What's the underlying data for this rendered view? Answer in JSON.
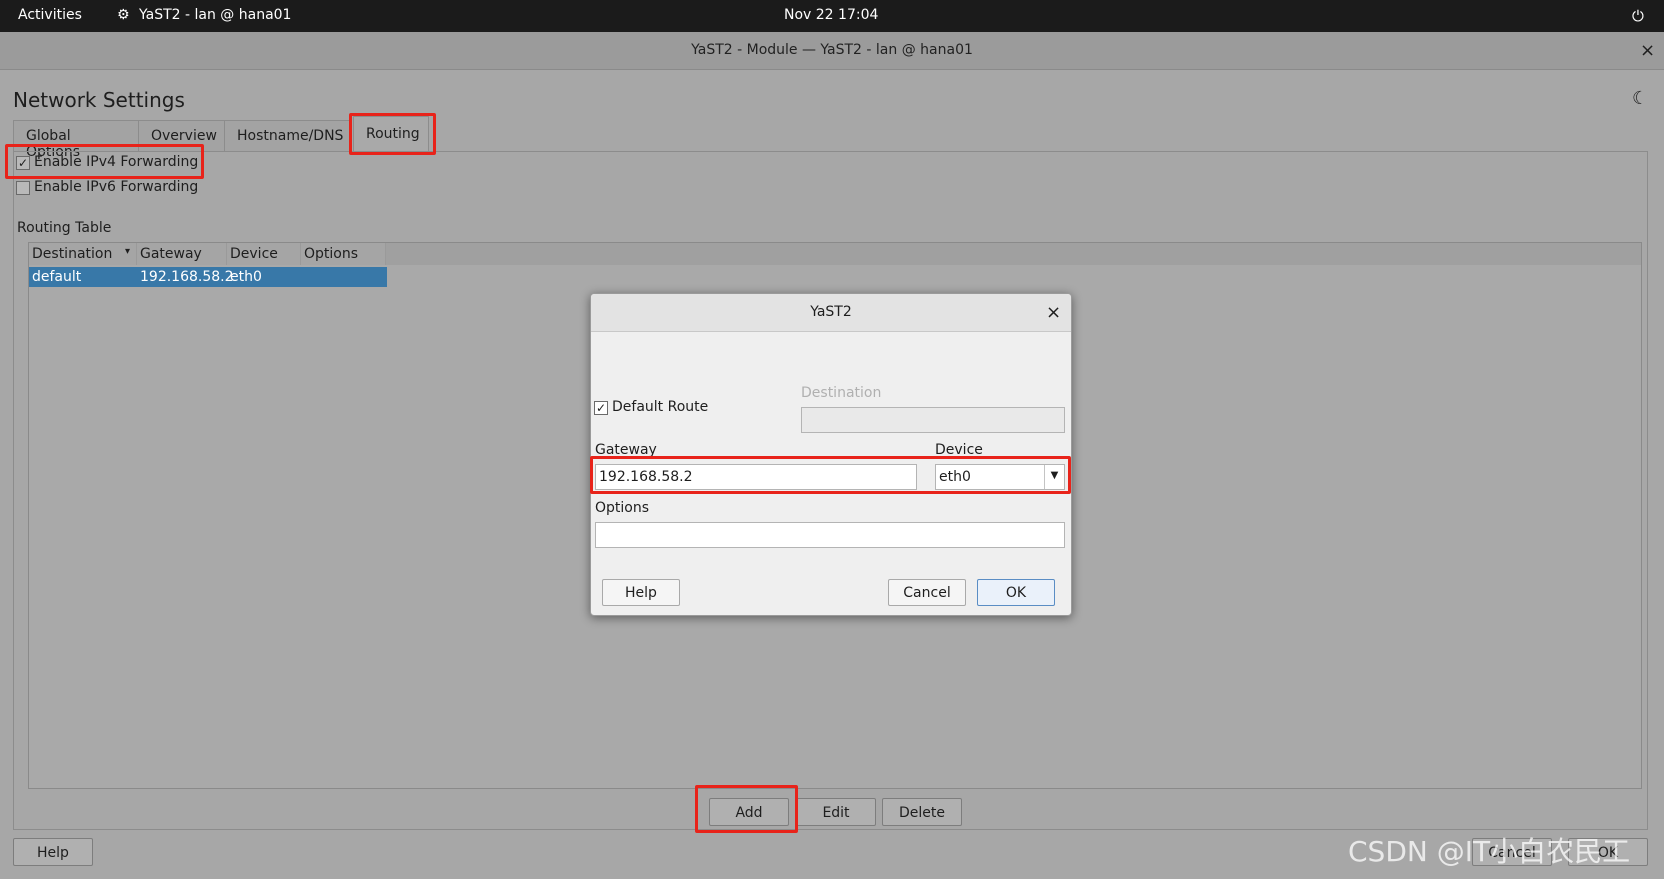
{
  "topbar": {
    "activities": "Activities",
    "app_name": "YaST2 - lan @ hana01",
    "clock": "Nov 22  17:04"
  },
  "window": {
    "title": "YaST2 - Module — YaST2 - lan @ hana01",
    "close": "×"
  },
  "page": {
    "title": "Network Settings",
    "tabs": [
      "Global Options",
      "Overview",
      "Hostname/DNS",
      "Routing"
    ],
    "active_tab": "Routing"
  },
  "routing": {
    "ipv4_label": "Enable IPv4 Forwarding",
    "ipv4_checked": true,
    "ipv6_label": "Enable IPv6 Forwarding",
    "ipv6_checked": false,
    "table_title": "Routing Table",
    "columns": [
      "Destination",
      "Gateway",
      "Device",
      "Options"
    ],
    "rows": [
      {
        "destination": "default",
        "gateway": "192.168.58.2",
        "device": "eth0",
        "options": ""
      }
    ],
    "add": "Add",
    "edit": "Edit",
    "delete": "Delete"
  },
  "footer": {
    "help": "Help",
    "cancel": "Cancel",
    "ok": "OK",
    "watermark": "CSDN @IT小白农民工"
  },
  "dialog": {
    "title": "YaST2",
    "close": "×",
    "default_route_label": "Default Route",
    "default_route_checked": true,
    "destination_label": "Destination",
    "destination_value": "",
    "gateway_label": "Gateway",
    "gateway_value": "192.168.58.2",
    "device_label": "Device",
    "device_value": "eth0",
    "options_label": "Options",
    "options_value": "",
    "help": "Help",
    "cancel": "Cancel",
    "ok": "OK"
  },
  "colors": {
    "highlight": "#e8231a",
    "selection": "#3878a8"
  }
}
